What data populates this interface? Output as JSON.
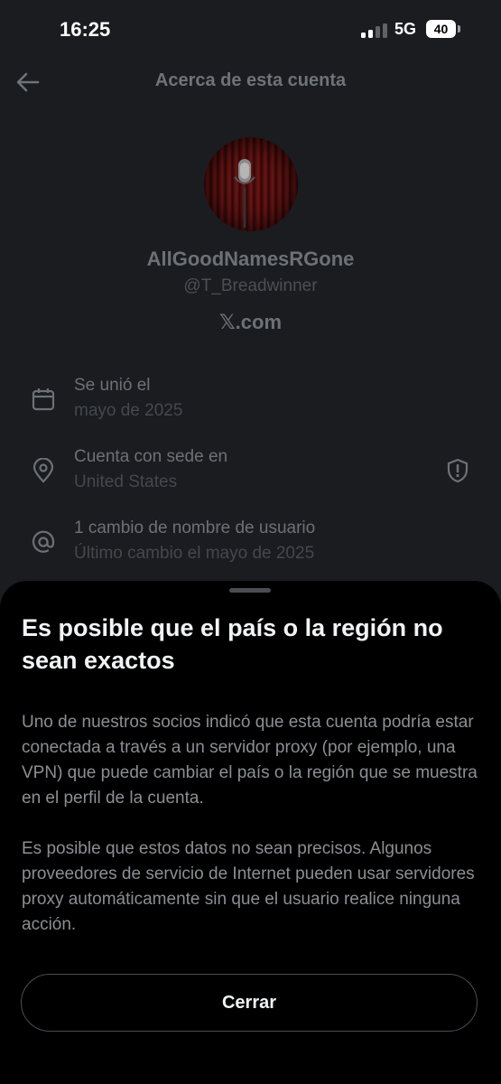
{
  "status_bar": {
    "time": "16:25",
    "network": "5G",
    "battery": "40"
  },
  "header": {
    "title": "Acerca de esta cuenta",
    "back_icon": "back-arrow-icon"
  },
  "profile": {
    "name": "AllGoodNamesRGone",
    "handle": "@T_Breadwinner",
    "site": "𝕏.com"
  },
  "info": [
    {
      "icon": "calendar-icon",
      "label": "Se unió el",
      "value": "mayo de 2025"
    },
    {
      "icon": "location-pin-icon",
      "label": "Cuenta con sede en",
      "value": "United States"
    },
    {
      "icon": "at-sign-icon",
      "label": "1 cambio de nombre de usuario",
      "value": "Último cambio el mayo de 2025"
    }
  ],
  "sheet": {
    "title": "Es posible que el país o la región no sean exactos",
    "paragraph1": "Uno de nuestros socios indicó que esta cuenta podría estar conectada a través a un servidor proxy (por ejemplo, una VPN) que puede cambiar el país o la región que se muestra en el perfil de la cuenta.",
    "paragraph2": "Es posible que estos datos no sean precisos. Algunos proveedores de servicio de Internet pueden usar servidores proxy automáticamente sin que el usuario realice ninguna acción.",
    "close_label": "Cerrar"
  },
  "colors": {
    "background": "#1a1c1f",
    "sheet": "#000000",
    "text": "#e7e9ea",
    "muted": "#6d7176"
  }
}
